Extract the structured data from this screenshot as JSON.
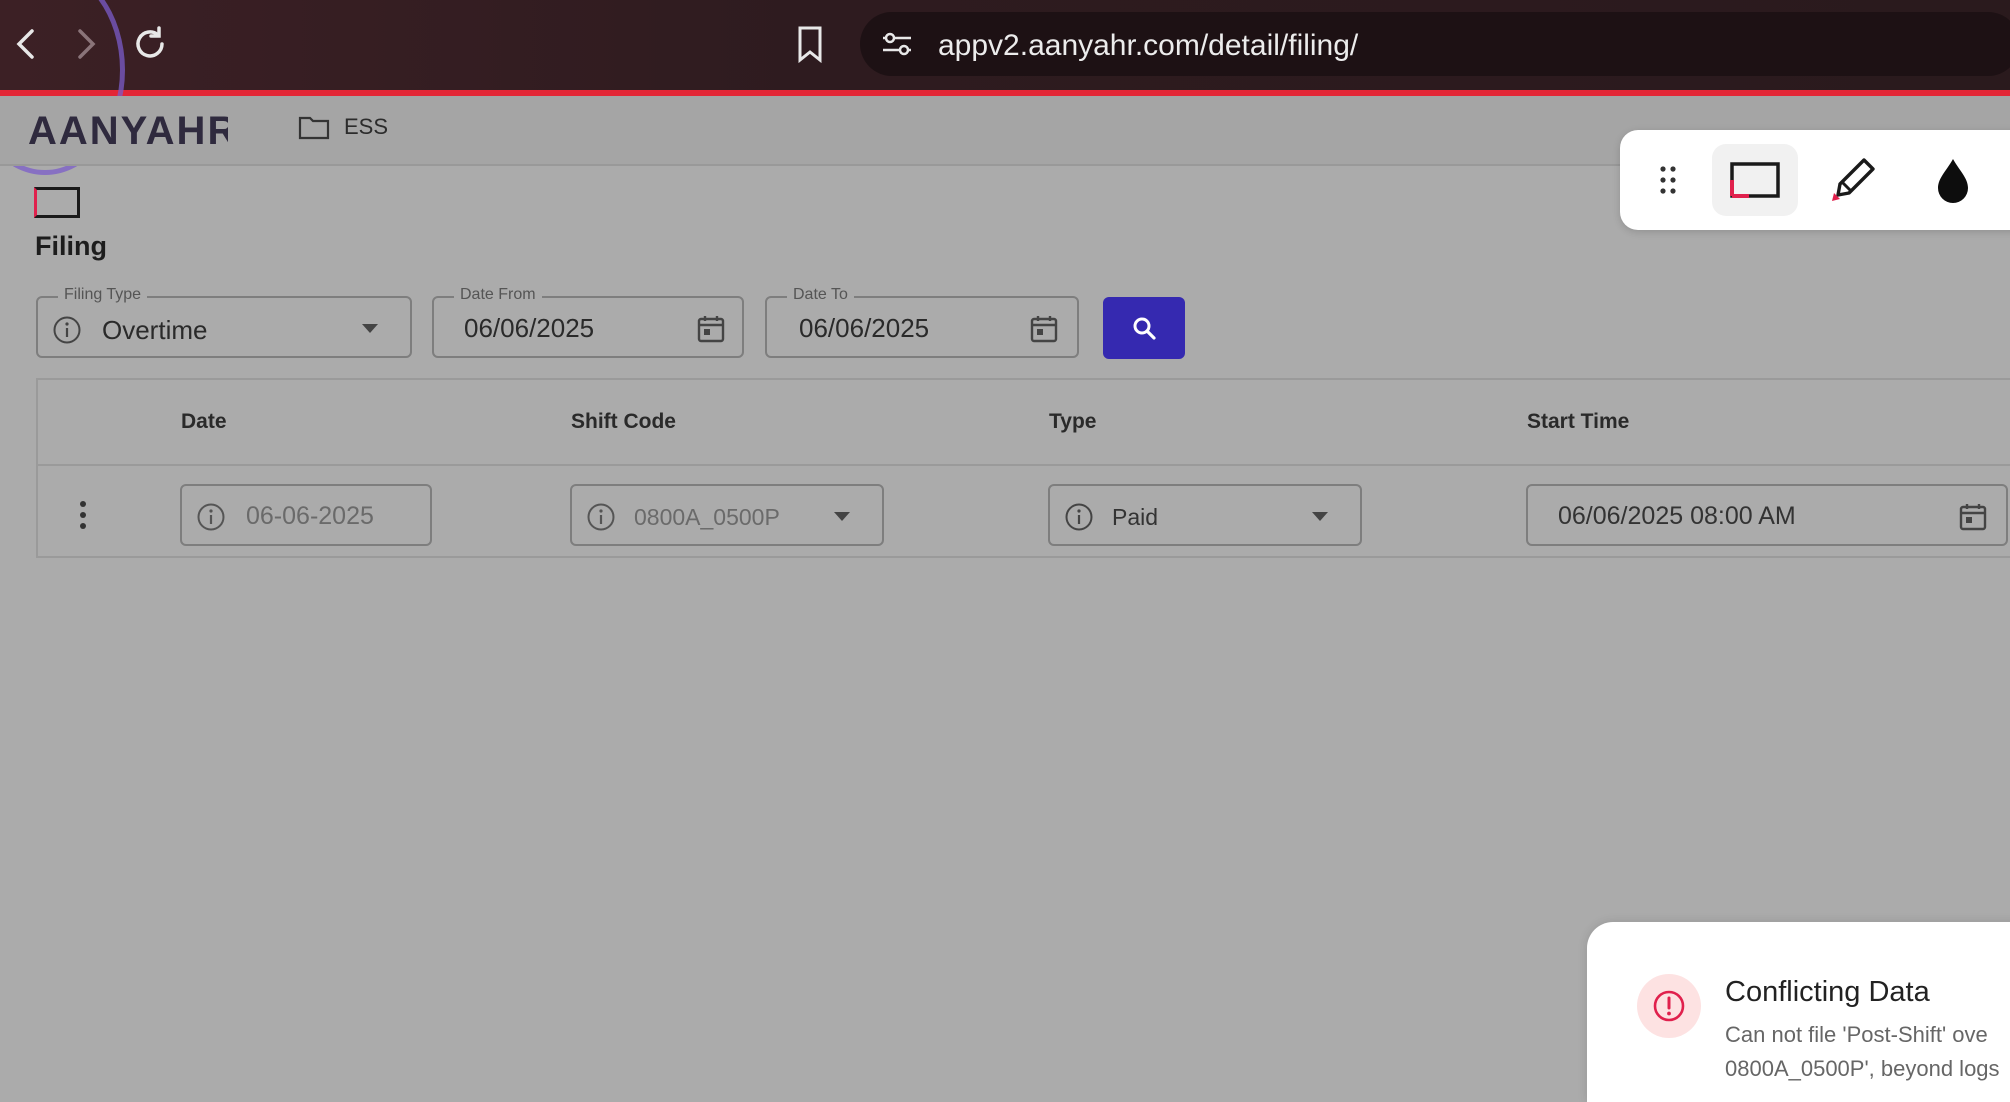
{
  "browser": {
    "url": "appv2.aanyahr.com/detail/filing/"
  },
  "header": {
    "logo_text": "AANYAHR",
    "breadcrumb": "ESS"
  },
  "page": {
    "title": "Filing"
  },
  "filters": {
    "filing_type": {
      "label": "Filing Type",
      "value": "Overtime"
    },
    "date_from": {
      "label": "Date From",
      "value": "06/06/2025"
    },
    "date_to": {
      "label": "Date To",
      "value": "06/06/2025"
    }
  },
  "table": {
    "columns": [
      "Date",
      "Shift Code",
      "Type",
      "Start Time"
    ],
    "rows": [
      {
        "date": "06-06-2025",
        "shift_code": "0800A_0500P",
        "type": "Paid",
        "start_time": "06/06/2025 08:00 AM"
      }
    ]
  },
  "toast": {
    "title": "Conflicting Data",
    "message_line1": "Can not file 'Post-Shift' ove",
    "message_line2": "0800A_0500P', beyond logs"
  },
  "colors": {
    "primary_button": "#3529b0",
    "chrome_accent": "#e32636",
    "error": "#e0214d"
  }
}
